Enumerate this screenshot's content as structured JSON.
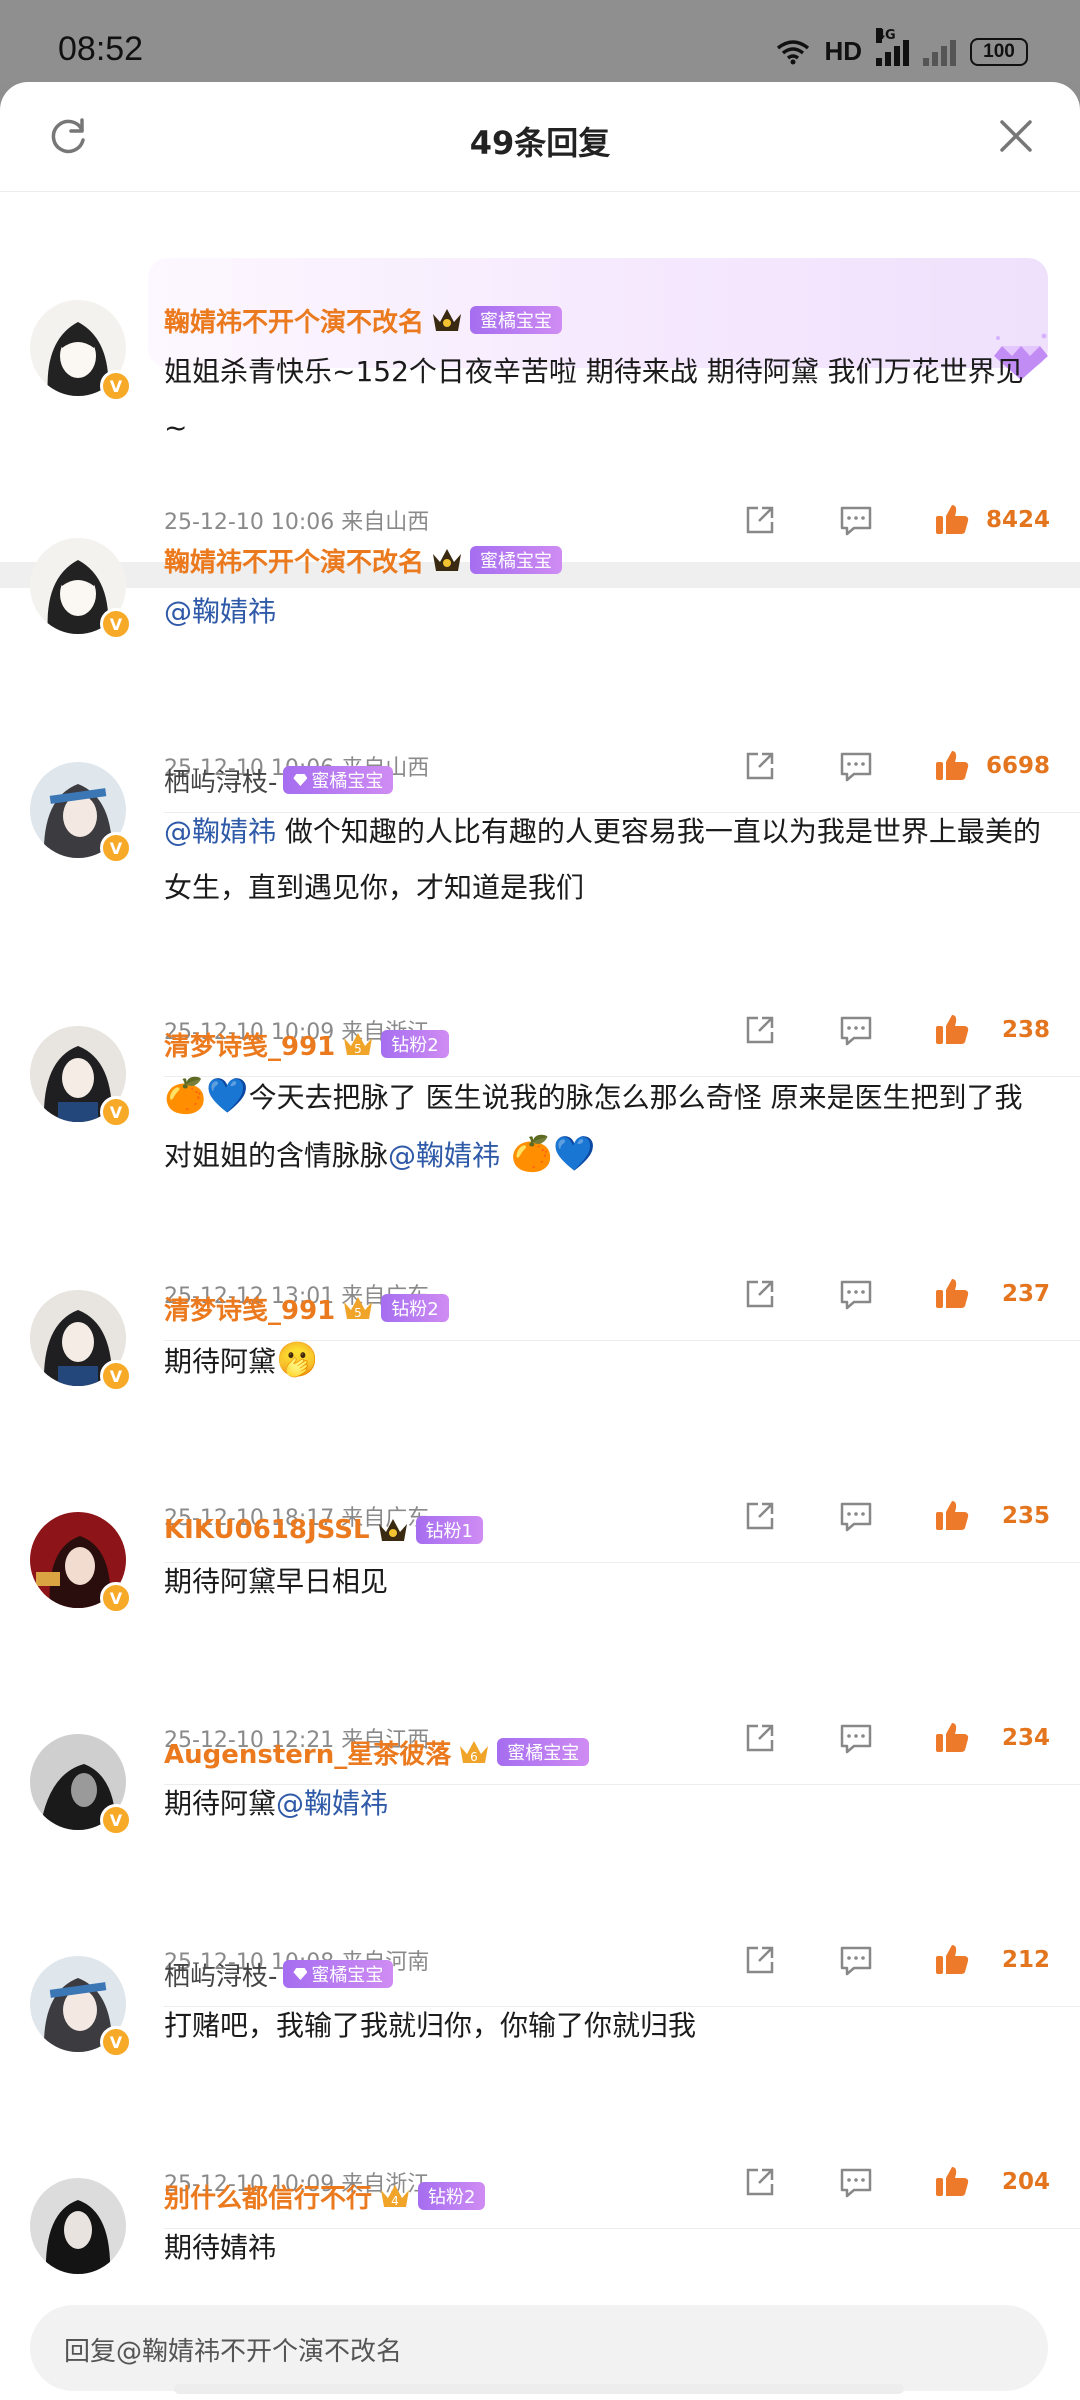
{
  "status_bar": {
    "time": "08:52",
    "network": "HD",
    "signal_tag": "4G",
    "battery": "100"
  },
  "header": {
    "title": "49条回复"
  },
  "comments": [
    {
      "user": "鞠婧祎不开个演不改名",
      "badge": "蜜橘宝宝",
      "text": "姐姐杀青快乐~152个日夜辛苦啦  期待来战  期待阿黛  我们万花世界见~",
      "time": "25-12-10  10:06  来自山西",
      "likes": "8424"
    },
    {
      "user": "鞠婧祎不开个演不改名",
      "badge": "蜜橘宝宝",
      "mention": "@鞠婧祎",
      "time": "25-12-10  10:06  来自山西",
      "likes": "6698"
    },
    {
      "user": "栖屿浔枝-",
      "badge": "蜜橘宝宝",
      "mention": "@鞠婧祎",
      "text": "  做个知趣的人比有趣的人更容易我一直以为我是世界上最美的女生，直到遇见你，才知道是我们",
      "time": "25-12-10  10:09  来自浙江",
      "likes": "238"
    },
    {
      "user": "清梦诗笺_991",
      "badge": "钻粉2",
      "level": "5",
      "emoji_lead": "🍊💙",
      "text": "今天去把脉了  医生说我的脉怎么那么奇怪  原来是医生把到了我对姐姐的含情脉脉",
      "mention": "@鞠婧祎",
      "emoji_tail": " 🍊💙",
      "time": "25-12-12  13:01  来自广东",
      "likes": "237"
    },
    {
      "user": "清梦诗笺_991",
      "badge": "钻粉2",
      "level": "5",
      "text": "期待阿黛",
      "emoji_tail": "🫢",
      "time": "25-12-10  18:17  来自广东",
      "likes": "235"
    },
    {
      "user": "KIKU0618JSSL",
      "badge": "钻粉1",
      "text": "期待阿黛早日相见",
      "time": "25-12-10  12:21  来自江西",
      "likes": "234"
    },
    {
      "user": "Augenstern_星茶彼落",
      "badge": "蜜橘宝宝",
      "level": "6",
      "text": "期待阿黛",
      "mention": "@鞠婧祎",
      "time": "25-12-10  10:08  来自河南",
      "likes": "212"
    },
    {
      "user": "栖屿浔枝-",
      "badge": "蜜橘宝宝",
      "text": "打赌吧，我输了我就归你，你输了你就归我",
      "time": "25-12-10  10:09  来自浙江",
      "likes": "204"
    },
    {
      "user": "别什么都信行不行",
      "badge": "钻粉2",
      "level": "4",
      "text": "期待婧祎"
    }
  ],
  "reply_bar": {
    "placeholder": "回复@鞠婧祎不开个演不改名"
  },
  "colors": {
    "accent": "#eb7a1e",
    "mention": "#2f5aa8",
    "badge": "#b47cf0"
  },
  "icons": [
    "refresh-icon",
    "close-icon",
    "share-icon",
    "reply-icon",
    "like-icon",
    "crown-icon",
    "verified-icon",
    "gem-icon"
  ]
}
